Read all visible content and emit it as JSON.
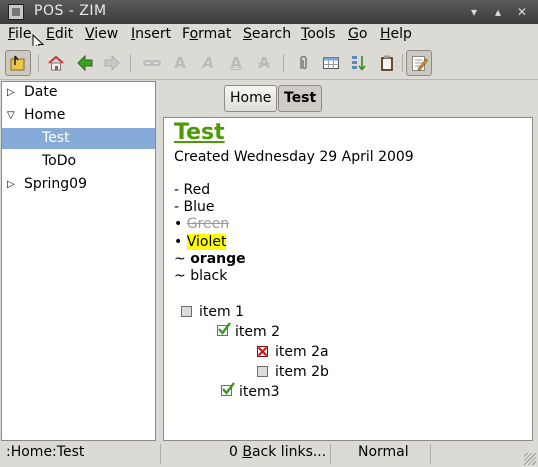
{
  "window": {
    "title": "POS - ZIM"
  },
  "menubar": {
    "items": [
      {
        "pre": "",
        "u": "F",
        "post": "ile"
      },
      {
        "pre": "",
        "u": "E",
        "post": "dit"
      },
      {
        "pre": "",
        "u": "V",
        "post": "iew"
      },
      {
        "pre": "",
        "u": "I",
        "post": "nsert"
      },
      {
        "pre": "F",
        "u": "o",
        "post": "rmat"
      },
      {
        "pre": "",
        "u": "S",
        "post": "earch"
      },
      {
        "pre": "",
        "u": "T",
        "post": "ools"
      },
      {
        "pre": "",
        "u": "G",
        "post": "o"
      },
      {
        "pre": "",
        "u": "H",
        "post": "elp"
      }
    ]
  },
  "toolbar": {
    "icons": [
      "index-toggle-icon",
      "home-icon",
      "back-icon",
      "forward-icon",
      "link-icon",
      "bold-icon",
      "italic-icon",
      "underline-icon",
      "strike-icon",
      "attach-icon",
      "table-icon",
      "sort-icon",
      "clipboard-icon",
      "edit-mode-icon"
    ]
  },
  "sidebar": {
    "items": [
      {
        "label": "Date"
      },
      {
        "label": "Home"
      },
      {
        "label": "Test"
      },
      {
        "label": "ToDo"
      },
      {
        "label": "Spring09"
      }
    ]
  },
  "pathbar": {
    "buttons": [
      {
        "label": "Home"
      },
      {
        "label": "Test"
      }
    ]
  },
  "page": {
    "title": "Test",
    "created": "Created Wednesday 29 April 2009",
    "lines": [
      {
        "prefix": "- ",
        "text": "Red"
      },
      {
        "prefix": "- ",
        "text": "Blue"
      },
      {
        "prefix": "• ",
        "text": "Green"
      },
      {
        "prefix": "• ",
        "text": "Violet"
      },
      {
        "prefix": "~ ",
        "text": "orange"
      },
      {
        "prefix": "~ ",
        "text": "black"
      }
    ],
    "checklist": [
      {
        "label": "item 1",
        "state": "unchecked"
      },
      {
        "label": "item 2",
        "state": "checked"
      },
      {
        "label": "item 2a",
        "state": "crossed"
      },
      {
        "label": "item 2b",
        "state": "unchecked"
      },
      {
        "label": "item3",
        "state": "checked"
      }
    ]
  },
  "statusbar": {
    "path": ":Home:Test",
    "backlinks_pre": "0 ",
    "backlinks_u": "B",
    "backlinks_post": "ack links...",
    "mode": "Normal"
  }
}
